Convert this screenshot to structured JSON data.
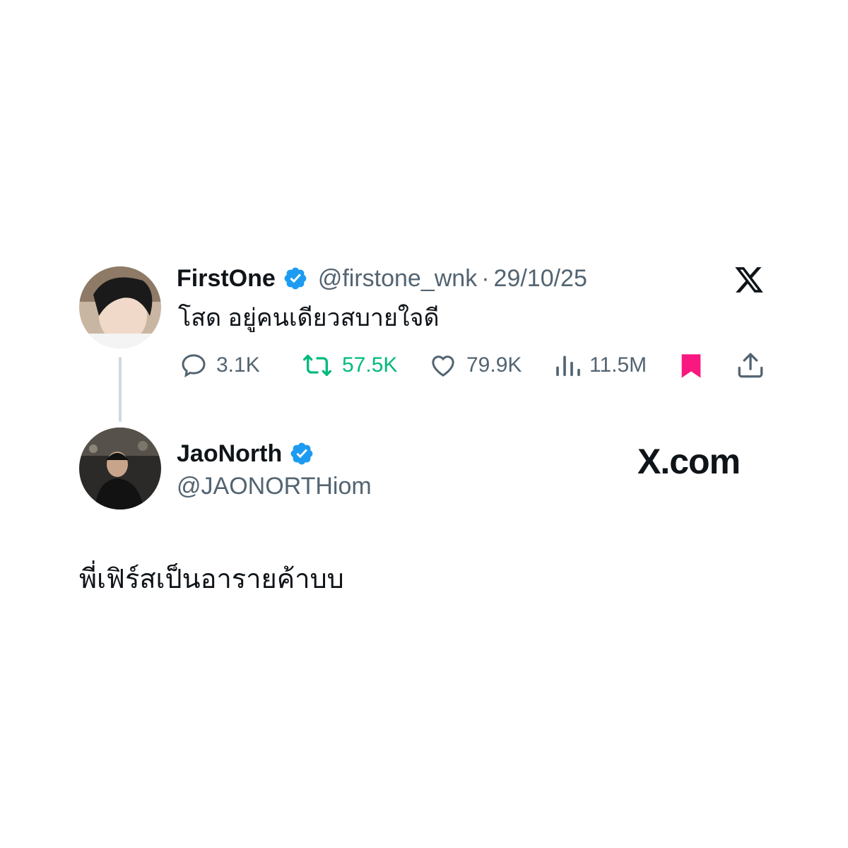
{
  "tweet": {
    "author_name": "FirstOne",
    "author_handle": "@firstone_wnk",
    "separator": "·",
    "date": "29/10/25",
    "text": "โสด อยู่คนเดียวสบายใจดี",
    "stats": {
      "replies": "3.1K",
      "retweets": "57.5K",
      "likes": "79.9K",
      "views": "11.5M"
    }
  },
  "reply": {
    "author_name": "JaoNorth",
    "author_handle": "@JAONORTHiom",
    "text": "พี่เฟิร์สเป็นอารายค้าบบ"
  },
  "watermark": "X.com",
  "colors": {
    "verified": "#1d9bf0",
    "retweet": "#00ba7c",
    "bookmark": "#f91880",
    "muted": "#536471",
    "text": "#0f1419"
  },
  "icons": [
    "x-logo-icon",
    "verified-badge-icon",
    "reply-icon",
    "retweet-icon",
    "like-icon",
    "views-icon",
    "bookmark-icon",
    "share-icon"
  ]
}
